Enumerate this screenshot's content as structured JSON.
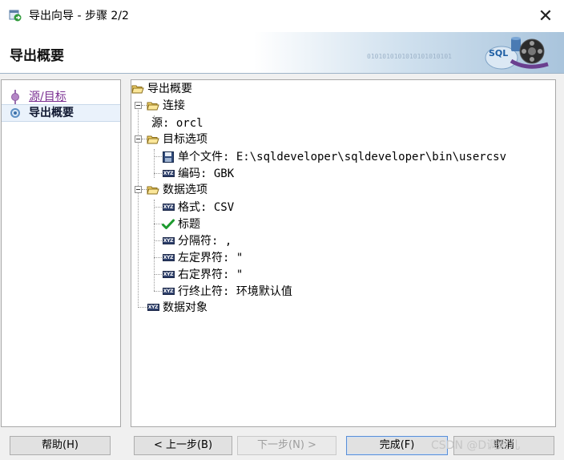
{
  "window": {
    "title": "导出向导 - 步骤 2/2",
    "close_glyph": "✕"
  },
  "header": {
    "page_title": "导出概要",
    "binary_text": "0101010101010101010101",
    "logo_label": "SQL",
    "accent_color": "#a9c4dc"
  },
  "nav": {
    "items": [
      {
        "label": "源/目标",
        "state": "done"
      },
      {
        "label": "导出概要",
        "state": "current"
      }
    ]
  },
  "tree": {
    "root": "导出概要",
    "connection": {
      "label": "连接",
      "source": "源: orcl"
    },
    "target": {
      "label": "目标选项",
      "file": "单个文件: E:\\sqldeveloper\\sqldeveloper\\bin\\usercsv",
      "encoding": "编码: GBK"
    },
    "data_options": {
      "label": "数据选项",
      "format": "格式: CSV",
      "header": "标题",
      "delimiter": "分隔符: ,",
      "left_enclosure": "左定界符: \"",
      "right_enclosure": "右定界符: \"",
      "line_terminator": "行终止符: 环境默认值"
    },
    "data_objects": "数据对象",
    "icon_names": {
      "folder": "folder-open-icon",
      "file": "floppy-disk-icon",
      "value": "xyz-value-icon",
      "check": "checkmark-icon"
    }
  },
  "buttons": {
    "help": "帮助(H)",
    "back": "< 上一步(B)",
    "next": "下一步(N) >",
    "finish": "完成(F)",
    "cancel": "取消"
  },
  "watermark": "CSDN @D调剩儿"
}
